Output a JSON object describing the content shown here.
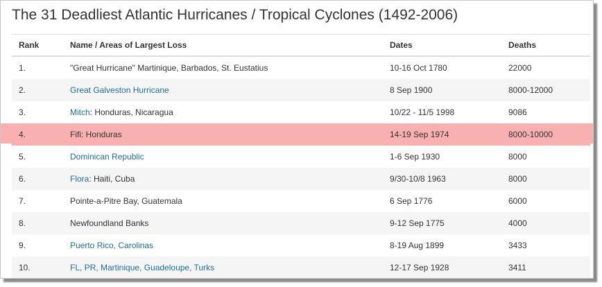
{
  "title": "The 31 Deadliest Atlantic Hurricanes / Tropical Cyclones (1492-2006)",
  "columns": {
    "rank": "Rank",
    "name": "Name / Areas of Largest Loss",
    "dates": "Dates",
    "deaths": "Deaths"
  },
  "colors": {
    "link": "#1f6e98",
    "highlight": "#f9b0b0",
    "stripe": "#f5f5f5"
  },
  "rows": [
    {
      "rank": "1.",
      "link": "",
      "rest": "\"Great Hurricane\" Martinique, Barbados, St. Eustatius",
      "dates": "10-16 Oct 1780",
      "deaths": "22000"
    },
    {
      "rank": "2.",
      "link": "Great Galveston Hurricane",
      "rest": "",
      "dates": "8 Sep 1900",
      "deaths": "8000-12000"
    },
    {
      "rank": "3.",
      "link": "Mitch",
      "rest": ": Honduras, Nicaragua",
      "dates": "10/22 - 11/5 1998",
      "deaths": "9086"
    },
    {
      "rank": "4.",
      "link": "",
      "rest": "Fifi: Honduras",
      "dates": "14-19 Sep 1974",
      "deaths": "8000-10000"
    },
    {
      "rank": "5.",
      "link": "Dominican Republic",
      "rest": "",
      "dates": "1-6 Sep 1930",
      "deaths": "8000"
    },
    {
      "rank": "6.",
      "link": "Flora",
      "rest": ": Haiti, Cuba",
      "dates": "9/30-10/8 1963",
      "deaths": "8000"
    },
    {
      "rank": "7.",
      "link": "",
      "rest": "Pointe-a-Pitre Bay, Guatemala",
      "dates": "6 Sep 1776",
      "deaths": "6000"
    },
    {
      "rank": "8.",
      "link": "",
      "rest": "Newfoundland Banks",
      "dates": "9-12 Sep 1775",
      "deaths": "4000"
    },
    {
      "rank": "9.",
      "link": "Puerto Rico, Carolinas",
      "rest": "",
      "dates": "8-19 Aug 1899",
      "deaths": "3433"
    },
    {
      "rank": "10.",
      "link": "FL, PR, Martinique, Guadeloupe, Turks",
      "rest": "",
      "dates": "12-17 Sep 1928",
      "deaths": "3411"
    }
  ]
}
